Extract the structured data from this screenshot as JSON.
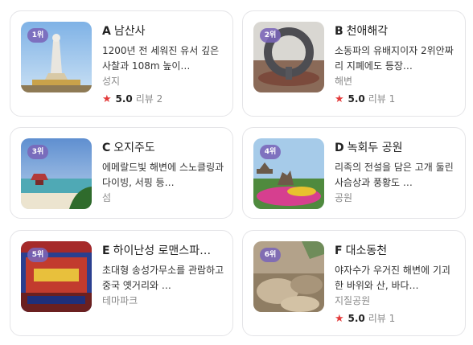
{
  "places": [
    {
      "rank": "1위",
      "letter": "A",
      "name": "남산사",
      "desc": "1200년 전 세워진 유서 깊은 사찰과 108m 높이…",
      "category": "성지",
      "score": "5.0",
      "review_label": "리뷰",
      "review_count": "2"
    },
    {
      "rank": "2위",
      "letter": "B",
      "name": "천애해각",
      "desc": "소동파의 유배지이자 2위안짜리 지폐에도 등장…",
      "category": "해변",
      "score": "5.0",
      "review_label": "리뷰",
      "review_count": "1"
    },
    {
      "rank": "3위",
      "letter": "C",
      "name": "오지주도",
      "desc": "에메랄드빛 해변에 스노클링과 다이빙, 서핑 등…",
      "category": "섬"
    },
    {
      "rank": "4위",
      "letter": "D",
      "name": "녹회두 공원",
      "desc": "리족의 전설을 담은 고개 둘린 사슴상과 풍황도 …",
      "category": "공원"
    },
    {
      "rank": "5위",
      "letter": "E",
      "name": "하이난성 로맨스파…",
      "desc": "초대형 송성가무소를 관람하고 중국 옛거리와 …",
      "category": "테마파크"
    },
    {
      "rank": "6위",
      "letter": "F",
      "name": "대소동천",
      "desc": "야자수가 우거진 해변에 기괴한 바위와 산, 바다…",
      "category": "지질공원",
      "score": "5.0",
      "review_label": "리뷰",
      "review_count": "1"
    }
  ],
  "icons": {
    "rating": "star-icon"
  },
  "colors": {
    "rank_badge": "#7a65b8",
    "star": "#e33b3b",
    "card_border": "#e4e4e7"
  }
}
